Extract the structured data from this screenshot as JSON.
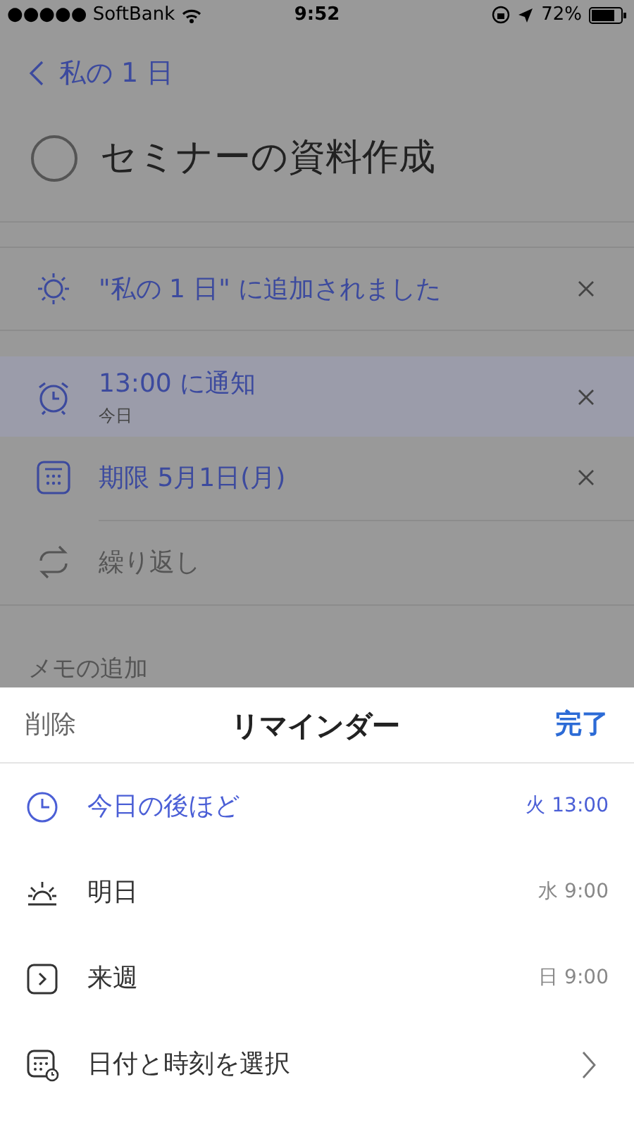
{
  "status_bar": {
    "carrier": "●●●●● SoftBank",
    "time": "9:52",
    "battery": "72%"
  },
  "nav": {
    "back_label": "私の 1 日"
  },
  "task": {
    "title": "セミナーの資料作成",
    "completed": false
  },
  "details": [
    {
      "kind": "my_day",
      "label": "\"私の 1 日\" に追加されました",
      "set": true,
      "selected": false
    },
    {
      "kind": "reminder",
      "label": "13:00 に通知",
      "sublabel": "今日",
      "set": true,
      "selected": true
    },
    {
      "kind": "due",
      "label": "期限 5月1日(月)",
      "set": true,
      "selected": false
    },
    {
      "kind": "repeat",
      "label": "繰り返し",
      "set": false,
      "selected": false
    }
  ],
  "note": {
    "placeholder": "メモの追加"
  },
  "sheet": {
    "left_action": "削除",
    "title": "リマインダー",
    "right_action": "完了",
    "options": [
      {
        "kind": "later_today",
        "label": "今日の後ほど",
        "time": "火 13:00",
        "selected": true
      },
      {
        "kind": "tomorrow",
        "label": "明日",
        "time": "水 9:00",
        "selected": false
      },
      {
        "kind": "next_week",
        "label": "来週",
        "time": "日 9:00",
        "selected": false
      },
      {
        "kind": "pick_date",
        "label": "日付と時刻を選択",
        "selected": false
      }
    ]
  }
}
